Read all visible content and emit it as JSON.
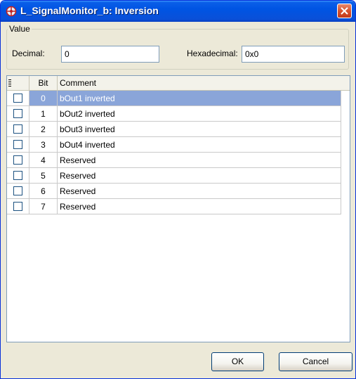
{
  "window": {
    "title": "L_SignalMonitor_b: Inversion"
  },
  "value_group": {
    "legend": "Value",
    "decimal_label": "Decimal:",
    "decimal_value": "0",
    "hex_label": "Hexadecimal:",
    "hex_value": "0x0"
  },
  "table": {
    "columns": [
      "",
      "Bit",
      "Comment"
    ],
    "selected_row": 0,
    "rows": [
      {
        "checked": false,
        "bit": "0",
        "comment": "bOut1 inverted"
      },
      {
        "checked": false,
        "bit": "1",
        "comment": "bOut2 inverted"
      },
      {
        "checked": false,
        "bit": "2",
        "comment": "bOut3 inverted"
      },
      {
        "checked": false,
        "bit": "3",
        "comment": "bOut4 inverted"
      },
      {
        "checked": false,
        "bit": "4",
        "comment": "Reserved"
      },
      {
        "checked": false,
        "bit": "5",
        "comment": "Reserved"
      },
      {
        "checked": false,
        "bit": "6",
        "comment": "Reserved"
      },
      {
        "checked": false,
        "bit": "7",
        "comment": "Reserved"
      }
    ]
  },
  "buttons": {
    "ok": "OK",
    "cancel": "Cancel"
  },
  "colors": {
    "titlebar": "#0054e3",
    "selection": "#8aa5d9",
    "close": "#d8532e"
  },
  "icons": {
    "app": "app-icon",
    "close": "close-icon"
  }
}
